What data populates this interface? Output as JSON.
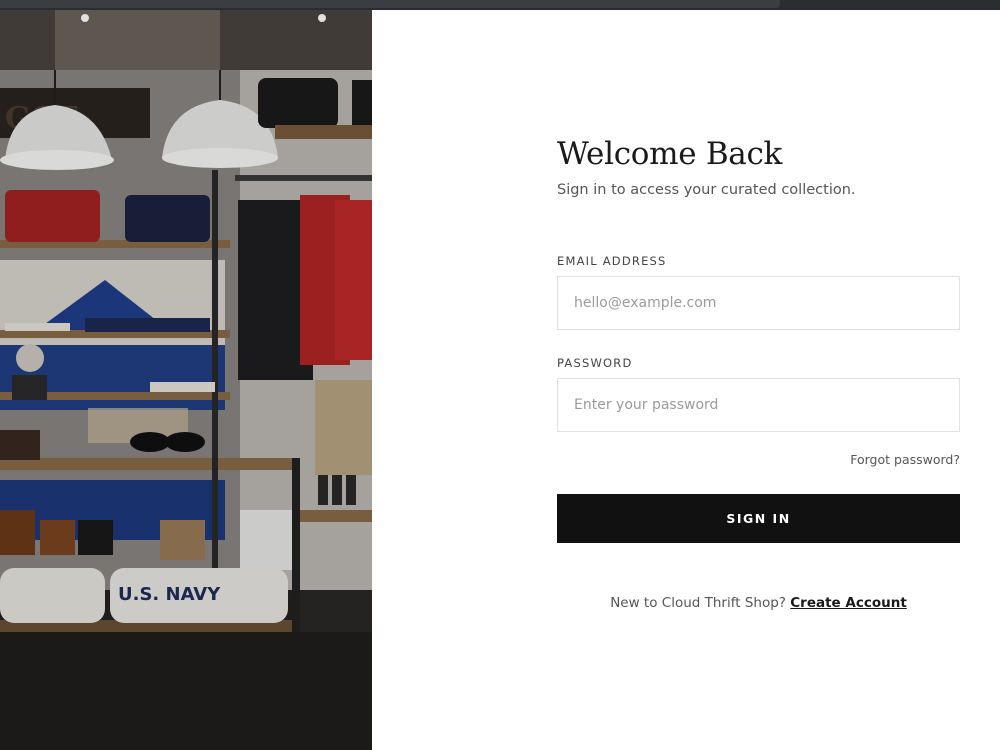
{
  "hero": {
    "image_name": "clothing-store-photo",
    "sign_text": "U.S. NAVY"
  },
  "form": {
    "title": "Welcome Back",
    "subtitle": "Sign in to access your curated collection.",
    "email_label": "EMAIL ADDRESS",
    "email_placeholder": "hello@example.com",
    "password_label": "PASSWORD",
    "password_placeholder": "Enter your password",
    "forgot_label": "Forgot password?",
    "signin_label": "SIGN IN",
    "signup_prompt": "New to Cloud Thrift Shop?",
    "signup_link": "Create Account"
  },
  "colors": {
    "button_bg": "#111111",
    "button_text": "#ffffff",
    "input_border": "#e2e2e2"
  }
}
